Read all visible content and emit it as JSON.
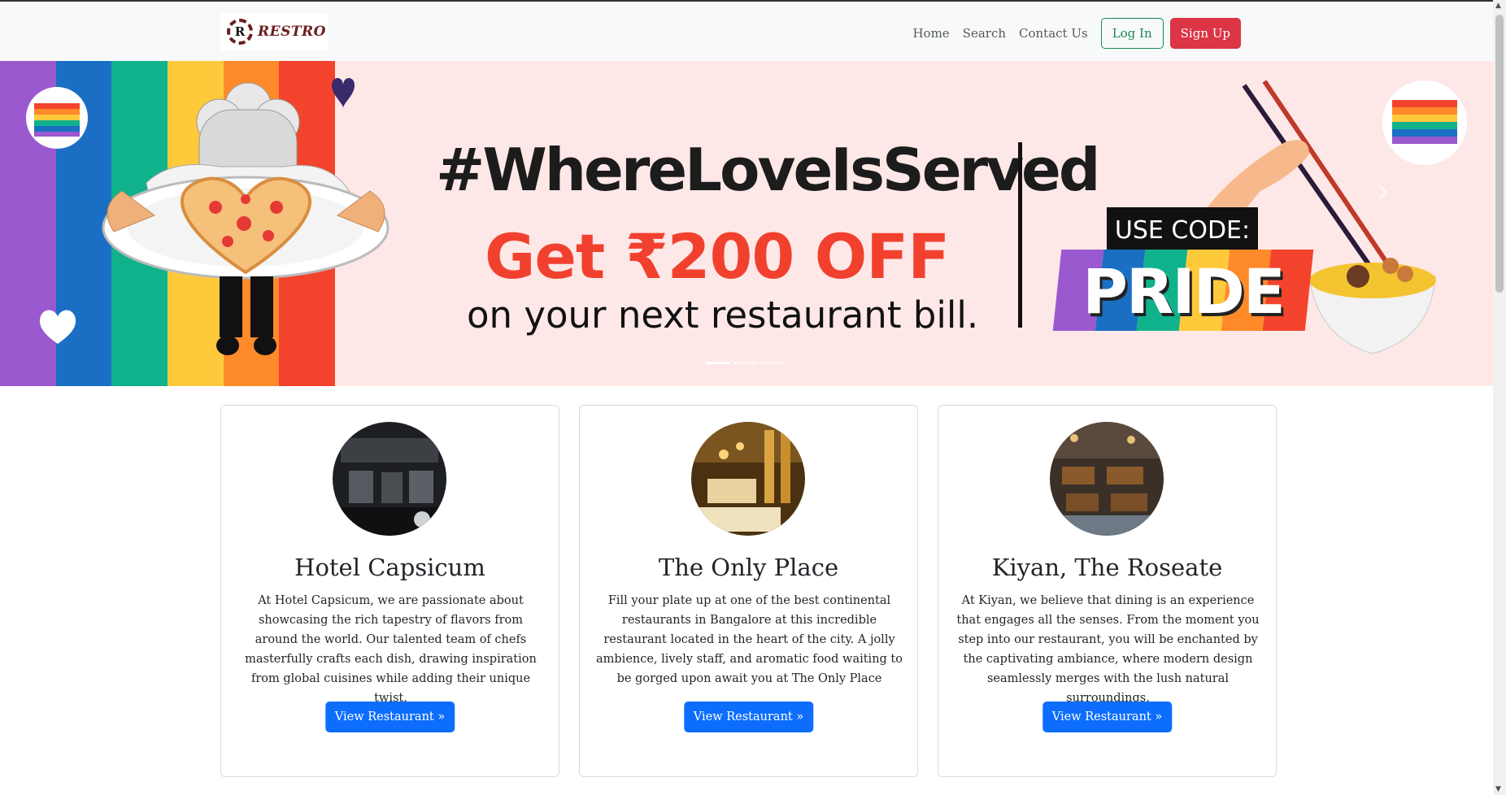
{
  "brand": {
    "letter": "R",
    "name": "RESTRO"
  },
  "nav": {
    "links": [
      "Home",
      "Search",
      "Contact Us"
    ],
    "login_label": "Log In",
    "signup_label": "Sign Up"
  },
  "banner": {
    "hashtag": "#WhereLoveIsServed",
    "offer": "Get ₹200 OFF",
    "offer_sub": "on your next restaurant bill.",
    "use_code": "USE CODE:",
    "code": "PRIDE",
    "slide_count": 3,
    "active_slide": 1
  },
  "cards": [
    {
      "title": "Hotel Capsicum",
      "text": "At Hotel Capsicum, we are passionate about showcasing the rich tapestry of flavors from around the world. Our talented team of chefs masterfully crafts each dish, drawing inspiration from global cuisines while adding their unique twist.",
      "button": "View Restaurant »"
    },
    {
      "title": "The Only Place",
      "text": "Fill your plate up at one of the best continental restaurants in Bangalore at this incredible restaurant located in the heart of the city. A jolly ambience, lively staff, and aromatic food waiting to be gorged upon await you at The Only Place",
      "button": "View Restaurant »"
    },
    {
      "title": "Kiyan, The Roseate",
      "text": "At Kiyan, we believe that dining is an experience that engages all the senses. From the moment you step into our restaurant, you will be enchanted by the captivating ambiance, where modern design seamlessly merges with the lush natural surroundings.",
      "button": "View Restaurant »"
    }
  ],
  "colors": {
    "login": "#198754",
    "signup": "#dc3545",
    "primary": "#0d6efd",
    "banner_bg": "#fde8e7",
    "offer": "#f1412e",
    "rainbow": [
      "#9b59d0",
      "#1a6fc4",
      "#10b28c",
      "#ffc93c",
      "#ff8a2a",
      "#f4432c"
    ]
  },
  "scrollbar": {
    "up_icon": "▲",
    "down_icon": "▼"
  }
}
